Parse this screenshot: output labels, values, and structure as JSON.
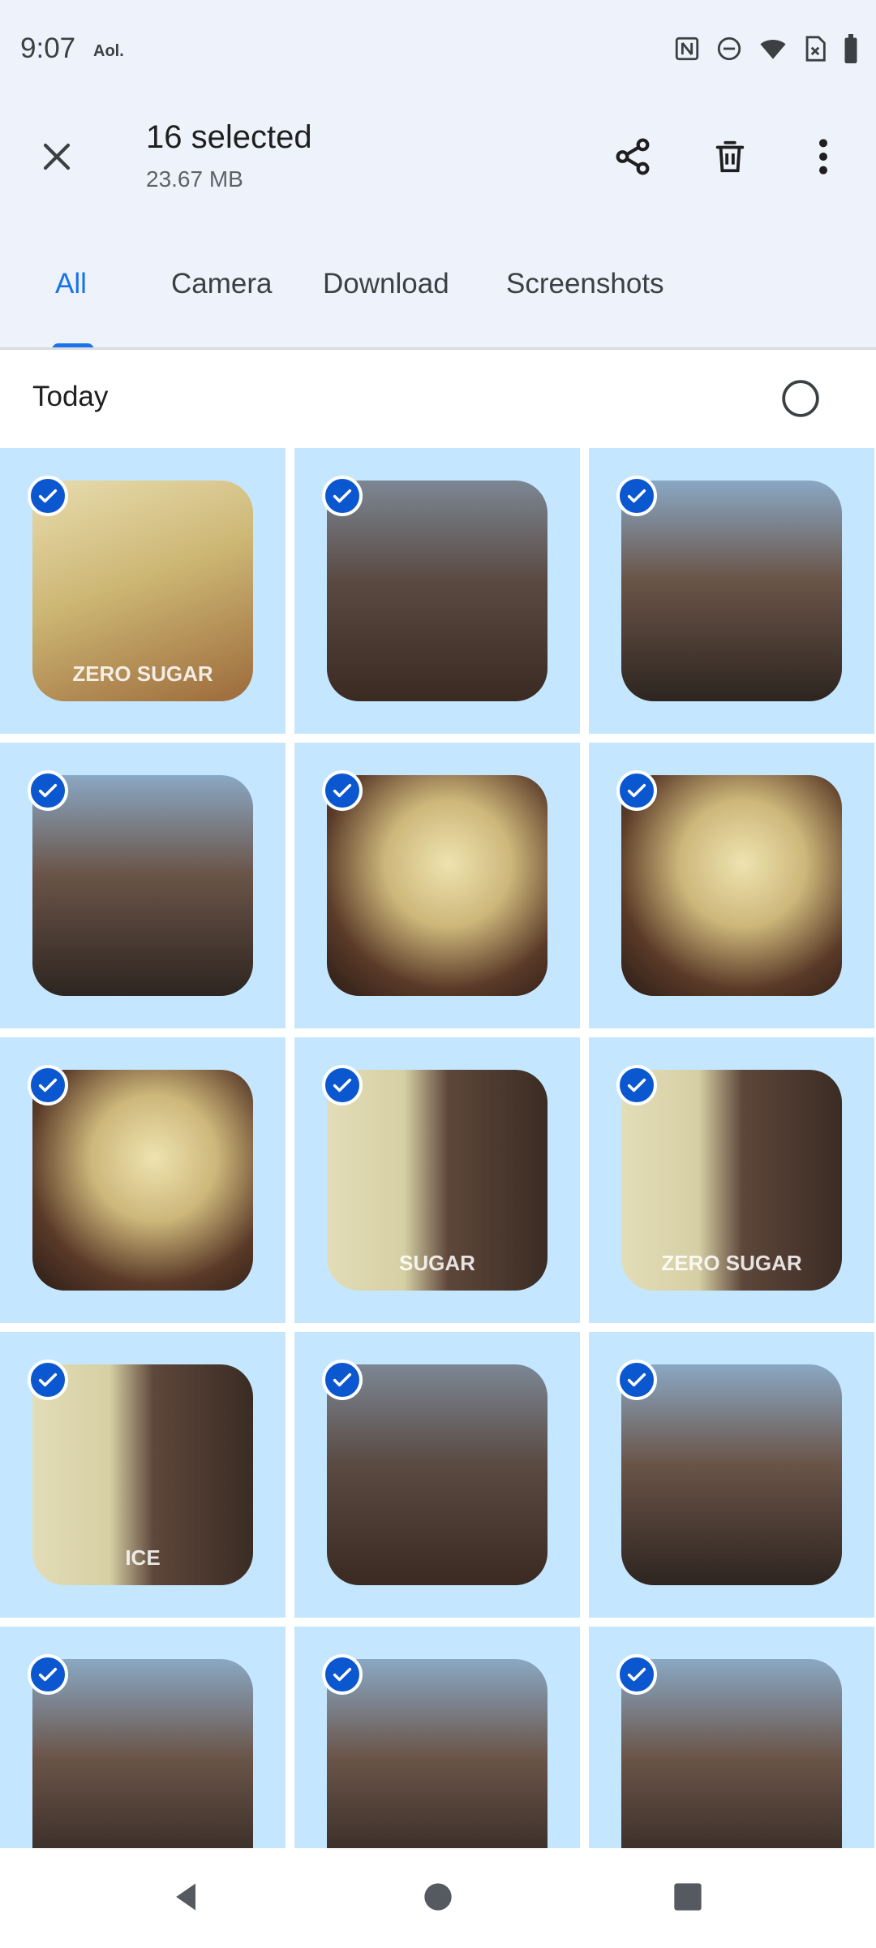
{
  "status_bar": {
    "time": "9:07",
    "carrier": "Aol.",
    "icons": [
      "nfc-icon",
      "do-not-disturb-icon",
      "wifi-icon",
      "no-sim-icon",
      "battery-icon"
    ]
  },
  "app_bar": {
    "close_icon": "close-icon",
    "title": "16 selected",
    "subtitle": "23.67 MB",
    "actions": [
      "share-icon",
      "delete-icon",
      "more-vert-icon"
    ]
  },
  "tabs": {
    "items": [
      {
        "label": "All",
        "active": true
      },
      {
        "label": "Camera",
        "active": false
      },
      {
        "label": "Download",
        "active": false
      },
      {
        "label": "Screenshots",
        "active": false
      }
    ]
  },
  "section": {
    "title": "Today",
    "select_icon": "radio-unselected-icon"
  },
  "photos": [
    {
      "subject": "lemonade-bottle",
      "text": "ZERO SUGAR",
      "selected": true
    },
    {
      "subject": "selfie",
      "text": "",
      "selected": true
    },
    {
      "subject": "selfie-drinking",
      "text": "",
      "selected": true
    },
    {
      "subject": "selfie-drinking",
      "text": "",
      "selected": true
    },
    {
      "subject": "bottle-in-hand",
      "text": "",
      "selected": true
    },
    {
      "subject": "bottle-in-hand",
      "text": "",
      "selected": true
    },
    {
      "subject": "bottle-in-hand",
      "text": "",
      "selected": true
    },
    {
      "subject": "selfie-with-bottle",
      "text": "SUGAR",
      "selected": true
    },
    {
      "subject": "selfie-with-bottle",
      "text": "ZERO SUGAR",
      "selected": true
    },
    {
      "subject": "selfie-with-bottle",
      "text": "ICE",
      "selected": true
    },
    {
      "subject": "selfie",
      "text": "",
      "selected": true
    },
    {
      "subject": "selfie-drinking",
      "text": "",
      "selected": true
    },
    {
      "subject": "selfie-drinking",
      "text": "",
      "selected": true
    },
    {
      "subject": "selfie-drinking",
      "text": "",
      "selected": true
    },
    {
      "subject": "selfie-drinking",
      "text": "",
      "selected": true
    }
  ],
  "colors": {
    "accent": "#1a73e8",
    "selected_cell": "#c4e7ff",
    "check": "#0b57d0",
    "top_background": "#eef3fb"
  },
  "nav_bar": {
    "buttons": [
      "back-icon",
      "home-icon",
      "recents-icon"
    ]
  }
}
